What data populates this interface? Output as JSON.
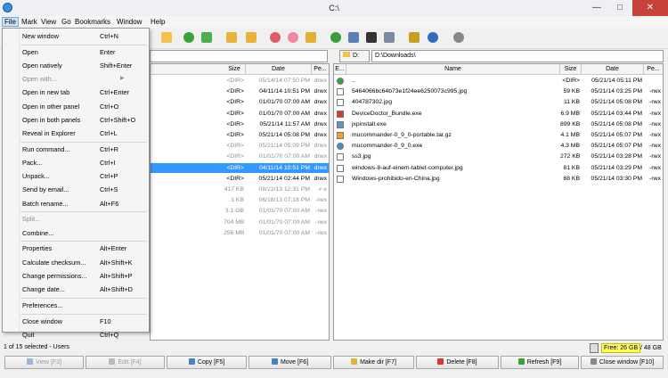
{
  "window": {
    "title": "C:\\",
    "minimize": "—",
    "maximize": "□",
    "close": "✕"
  },
  "menubar": [
    "File",
    "Mark",
    "View",
    "Go",
    "Bookmarks",
    "Window",
    "Help"
  ],
  "file_menu": [
    {
      "label": "New window",
      "shortcut": "Ctrl+N"
    },
    {
      "label": "Open",
      "shortcut": "Enter"
    },
    {
      "label": "Open natively",
      "shortcut": "Shift+Enter"
    },
    {
      "label": "Open with...",
      "shortcut": "",
      "disabled": true,
      "submenu": true
    },
    {
      "label": "Open in new tab",
      "shortcut": "Ctrl+Enter"
    },
    {
      "label": "Open in other panel",
      "shortcut": "Ctrl+O"
    },
    {
      "label": "Open in both panels",
      "shortcut": "Ctrl+Shift+O"
    },
    {
      "label": "Reveal in Explorer",
      "shortcut": "Ctrl+L"
    },
    {
      "label": "Run command...",
      "shortcut": "Ctrl+R"
    },
    {
      "label": "Pack...",
      "shortcut": "Ctrl+I"
    },
    {
      "label": "Unpack...",
      "shortcut": "Ctrl+P"
    },
    {
      "label": "Send by email...",
      "shortcut": "Ctrl+S"
    },
    {
      "label": "Batch rename...",
      "shortcut": "Alt+F6"
    },
    {
      "label": "Split...",
      "shortcut": "",
      "disabled": true
    },
    {
      "label": "Combine...",
      "shortcut": ""
    },
    {
      "label": "Properties",
      "shortcut": "Alt+Enter"
    },
    {
      "label": "Calculate checksum...",
      "shortcut": "Alt+Shift+K"
    },
    {
      "label": "Change permissions...",
      "shortcut": "Alt+Shift+P"
    },
    {
      "label": "Change date...",
      "shortcut": "Alt+Shift+D"
    },
    {
      "label": "Preferences...",
      "shortcut": ""
    },
    {
      "label": "Close window",
      "shortcut": "F10"
    },
    {
      "label": "Quit",
      "shortcut": "Ctrl+Q"
    }
  ],
  "left_panel": {
    "columns": [
      "Size",
      "Date",
      "Pe..."
    ],
    "rows": [
      {
        "size": "<DIR>",
        "date": "05/14/14 07:50 PM",
        "perm": "drwx",
        "gray": true
      },
      {
        "size": "<DIR>",
        "date": "04/11/14 10:51 PM",
        "perm": "drwx"
      },
      {
        "size": "<DIR>",
        "date": "01/01/70 07:00 AM",
        "perm": "drwx"
      },
      {
        "size": "<DIR>",
        "date": "01/01/70 07:00 AM",
        "perm": "drwx"
      },
      {
        "size": "<DIR>",
        "date": "05/21/14 11:57 AM",
        "perm": "drwx"
      },
      {
        "size": "<DIR>",
        "date": "05/21/14 05:08 PM",
        "perm": "drwx"
      },
      {
        "size": "<DIR>",
        "date": "05/21/14 05:09 PM",
        "perm": "drwx",
        "gray": true
      },
      {
        "size": "<DIR>",
        "date": "01/01/70 07:00 AM",
        "perm": "drwx",
        "gray": true
      },
      {
        "size": "<DIR>",
        "date": "04/11/14 10:51 PM",
        "perm": "drwx",
        "selected": true
      },
      {
        "size": "<DIR>",
        "date": "05/21/14 02:44 PM",
        "perm": "drwx"
      },
      {
        "size": "417 KB",
        "date": "08/22/13 12:31 PM",
        "perm": "-r-x",
        "gray": true
      },
      {
        "size": "1 KB",
        "date": "06/18/13 07:18 PM",
        "perm": "-rwx",
        "gray": true
      },
      {
        "size": "3.1 GB",
        "date": "01/01/70 07:00 AM",
        "perm": "-rwx",
        "gray": true
      },
      {
        "size": "704 MB",
        "date": "01/01/70 07:00 AM",
        "perm": "-rwx",
        "gray": true
      },
      {
        "size": "256 MB",
        "date": "01/01/70 07:00 AM",
        "perm": "-rwx",
        "gray": true
      }
    ]
  },
  "right_panel": {
    "drive": "D:",
    "path": "D:\\Downloads\\",
    "columns": [
      "E...",
      "Name",
      "Size",
      "Date",
      "Pe..."
    ],
    "rows": [
      {
        "name": "..",
        "size": "<DIR>",
        "date": "05/21/14 05:11 PM",
        "perm": "",
        "icon": "up-dir-icon",
        "color": "#3aa23a"
      },
      {
        "name": "5464066bc64b73e1f24ee6250073c995.jpg",
        "size": "59 KB",
        "date": "05/21/14 03:25 PM",
        "perm": "-rwx",
        "icon": "image-file-icon",
        "color": "#ffffff"
      },
      {
        "name": "404787302.jpg",
        "size": "11 KB",
        "date": "05/21/14 05:08 PM",
        "perm": "-rwx",
        "icon": "image-file-icon",
        "color": "#ffffff"
      },
      {
        "name": "DeviceDoctor_Bundle.exe",
        "size": "6.9 MB",
        "date": "05/21/14 03:44 PM",
        "perm": "-rwx",
        "icon": "exe-file-icon",
        "color": "#d9372b"
      },
      {
        "name": "jxpinstall.exe",
        "size": "899 KB",
        "date": "05/21/14 05:08 PM",
        "perm": "-rwx",
        "icon": "installer-icon",
        "color": "#6a8cc7"
      },
      {
        "name": "mucommander-0_9_0-portable.tar.gz",
        "size": "4.1 MB",
        "date": "05/21/14 05:07 PM",
        "perm": "-rwx",
        "icon": "archive-icon",
        "color": "#f0a030"
      },
      {
        "name": "mucommander-0_9_0.exe",
        "size": "4.3 MB",
        "date": "05/21/14 05:07 PM",
        "perm": "-rwx",
        "icon": "mucommander-icon",
        "color": "#3a8fd6"
      },
      {
        "name": "ss3.jpg",
        "size": "272 KB",
        "date": "05/21/14 03:28 PM",
        "perm": "-rwx",
        "icon": "image-file-icon",
        "color": "#ffffff"
      },
      {
        "name": "windows-8-auf-einem-tablet-computer.jpg",
        "size": "81 KB",
        "date": "05/21/14 03:29 PM",
        "perm": "-rwx",
        "icon": "image-file-icon",
        "color": "#ffffff"
      },
      {
        "name": "Windows-prohibido-en-China.jpg",
        "size": "68 KB",
        "date": "05/21/14 03:30 PM",
        "perm": "-rwx",
        "icon": "image-file-icon",
        "color": "#ffffff"
      }
    ]
  },
  "status": {
    "left": "1 of 15 selected - Users",
    "free": "Free: 26 GB",
    "total": "/ 48 GB"
  },
  "buttons": [
    {
      "label": "View [F3]",
      "disabled": true,
      "color": "#9ab6d8"
    },
    {
      "label": "Edit [F4]",
      "disabled": true,
      "color": "#bbbbbb"
    },
    {
      "label": "Copy [F5]",
      "color": "#4a7fc1"
    },
    {
      "label": "Move [F6]",
      "color": "#4a7fc1"
    },
    {
      "label": "Make dir [F7]",
      "color": "#e0b040"
    },
    {
      "label": "Delete [F8]",
      "color": "#d9372b"
    },
    {
      "label": "Refresh [F9]",
      "color": "#3aa23a"
    },
    {
      "label": "Close window [F10]",
      "color": "#888888"
    }
  ]
}
